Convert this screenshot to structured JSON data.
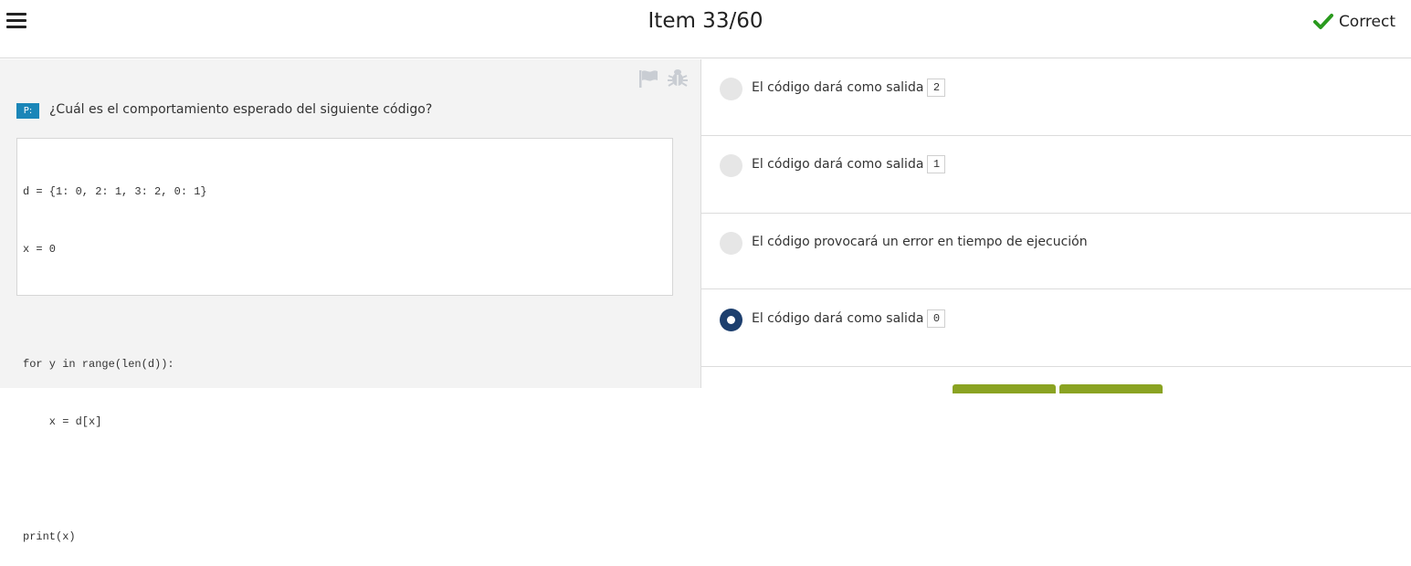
{
  "header": {
    "title": "Item 33/60",
    "status": "Correct",
    "status_color": "#2a9a1e",
    "menu_icon": "hamburger-menu-icon",
    "status_icon": "checkmark-icon"
  },
  "question": {
    "badge": "P:",
    "text": "¿Cuál es el comportamiento esperado del siguiente código?",
    "tool_icons": [
      "flag-icon",
      "bug-icon"
    ],
    "code_lines": [
      "d = {1: 0, 2: 1, 3: 2, 0: 1}",
      "x = 0",
      "",
      "for y in range(len(d)):",
      "    x = d[x]",
      "",
      "print(x)"
    ]
  },
  "options": [
    {
      "text": "El código dará como salida",
      "code": "2",
      "selected": false
    },
    {
      "text": "El código dará como salida",
      "code": "1",
      "selected": false
    },
    {
      "text": "El código provocará un error en tiempo de ejecución",
      "code": "",
      "selected": false
    },
    {
      "text": "El código dará como salida",
      "code": "0",
      "selected": true
    }
  ],
  "colors": {
    "accent_blue": "#1a86b8",
    "selected_radio": "#1d3f6e",
    "button_green": "#8aa322"
  }
}
